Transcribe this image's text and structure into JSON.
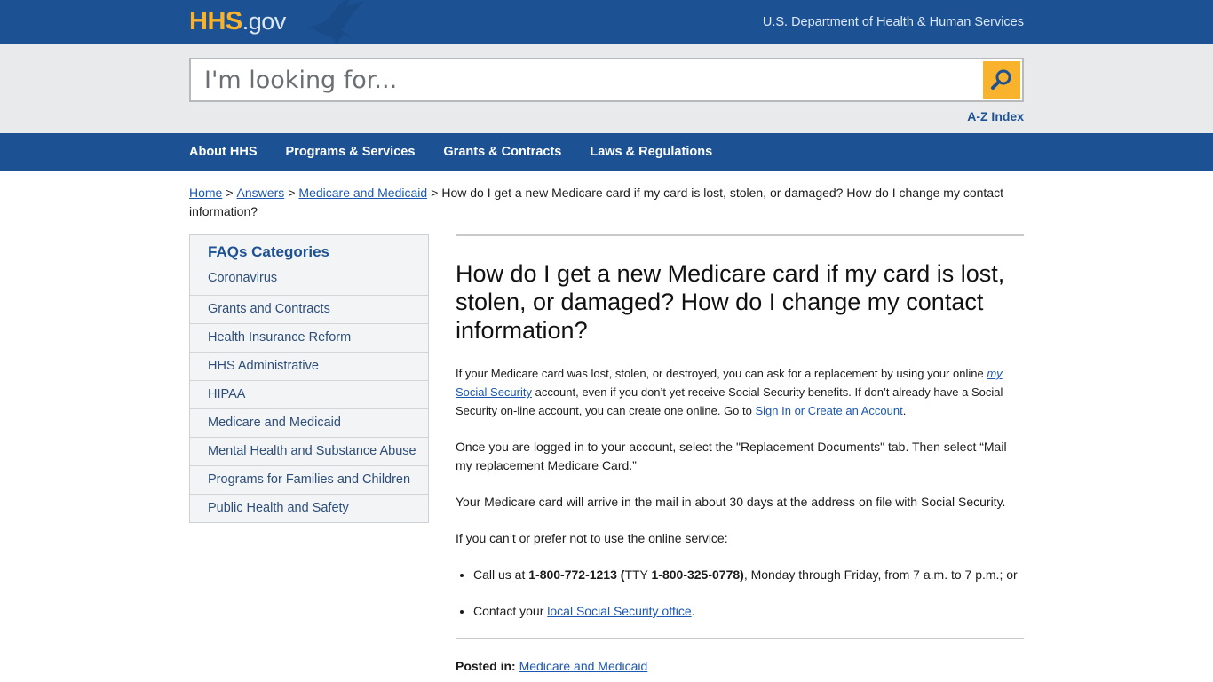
{
  "header": {
    "logo_hhs": "HHS",
    "logo_gov": ".gov",
    "department": "U.S. Department of Health & Human Services"
  },
  "search": {
    "placeholder": "I'm looking for...",
    "value": "",
    "button_icon": "search-icon",
    "az_index": "A-Z Index"
  },
  "nav": {
    "items": [
      {
        "label": "About HHS"
      },
      {
        "label": "Programs & Services"
      },
      {
        "label": "Grants & Contracts"
      },
      {
        "label": "Laws & Regulations"
      }
    ]
  },
  "breadcrumb": {
    "home": "Home",
    "answers": "Answers",
    "category": "Medicare and Medicaid",
    "separator": ">",
    "current": "How do I get a new Medicare card if my card is lost, stolen, or damaged? How do I change my contact information?"
  },
  "sidebar": {
    "title": "FAQs Categories",
    "items": [
      {
        "label": "Coronavirus"
      },
      {
        "label": "Grants and Contracts"
      },
      {
        "label": "Health Insurance Reform"
      },
      {
        "label": "HHS Administrative"
      },
      {
        "label": "HIPAA"
      },
      {
        "label": "Medicare and Medicaid"
      },
      {
        "label": "Mental Health and Substance Abuse"
      },
      {
        "label": "Programs for Families and Children"
      },
      {
        "label": "Public Health and Safety"
      }
    ]
  },
  "article": {
    "title": "How do I get a new Medicare card if my card is lost, stolen, or damaged? How do I change my contact information?",
    "p1_a": "If your Medicare card was lost, stolen, or destroyed, you can ask for a replacement by using your online ",
    "p1_link_my": "my",
    "p1_link_rest": " Social Security",
    "p1_b": " account, even if you don’t yet receive Social Security benefits. If don’t already have a Social Security on-line account, you can create one online. Go to ",
    "p1_link2": "Sign In or Create an Account",
    "p1_c": ".",
    "p2": "Once you are logged in to your account, select the \"Replacement Documents\" tab.  Then select “Mail my replacement Medicare Card.”",
    "p3": "Your Medicare card will arrive in the mail in about 30 days at the address on file with Social Security.",
    "p4": "If you can’t or prefer not to use the online service:",
    "li1_a": "Call us at ",
    "li1_phone": "1-800-772-1213 (",
    "li1_tty": "TTY ",
    "li1_tty_phone": "1-800-325-0778)",
    "li1_b": ", Monday through Friday, from 7 a.m. to 7 p.m.; or",
    "li2_a": "Contact your ",
    "li2_link": "local Social Security office",
    "li2_b": ".",
    "posted_label": "Posted in:",
    "posted_link": "Medicare and Medicaid"
  },
  "colors": {
    "brand_blue": "#1c5294",
    "accent_gold": "#f9b22c",
    "link": "#1c57b2"
  }
}
